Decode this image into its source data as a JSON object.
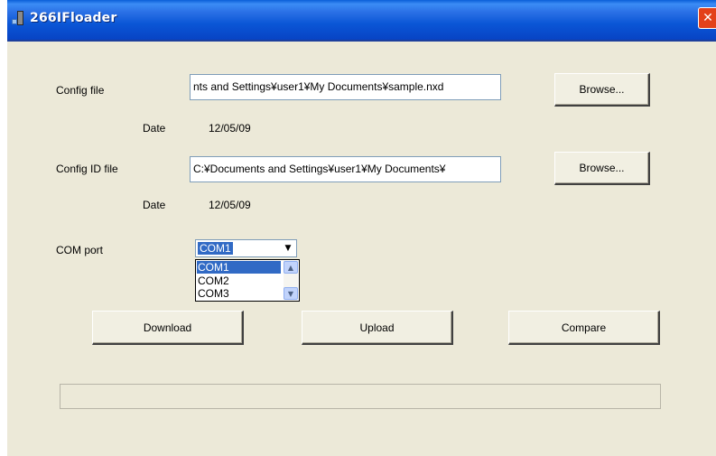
{
  "window": {
    "title": "266IFloader",
    "close_glyph": "✕"
  },
  "config": {
    "label": "Config file",
    "path": "nts and Settings¥user1¥My Documents¥sample.nxd",
    "browse_label": "Browse...",
    "date_label": "Date",
    "date_value": "12/05/09"
  },
  "config_id": {
    "label": "Config ID file",
    "path": "C:¥Documents and Settings¥user1¥My Documents¥",
    "browse_label": "Browse...",
    "date_label": "Date",
    "date_value": "12/05/09"
  },
  "com_port": {
    "label": "COM port",
    "selected": "COM1",
    "options": [
      "COM1",
      "COM2",
      "COM3"
    ],
    "arrow_glyph": "▼",
    "scroll_up_glyph": "▲",
    "scroll_down_glyph": "▼"
  },
  "actions": {
    "download_label": "Download",
    "upload_label": "Upload",
    "compare_label": "Compare"
  },
  "progress": {
    "value": 0
  },
  "colors": {
    "titlebar": "#0a56d6",
    "face": "#ece9d8",
    "selection": "#316ac5",
    "close": "#e3411a"
  }
}
